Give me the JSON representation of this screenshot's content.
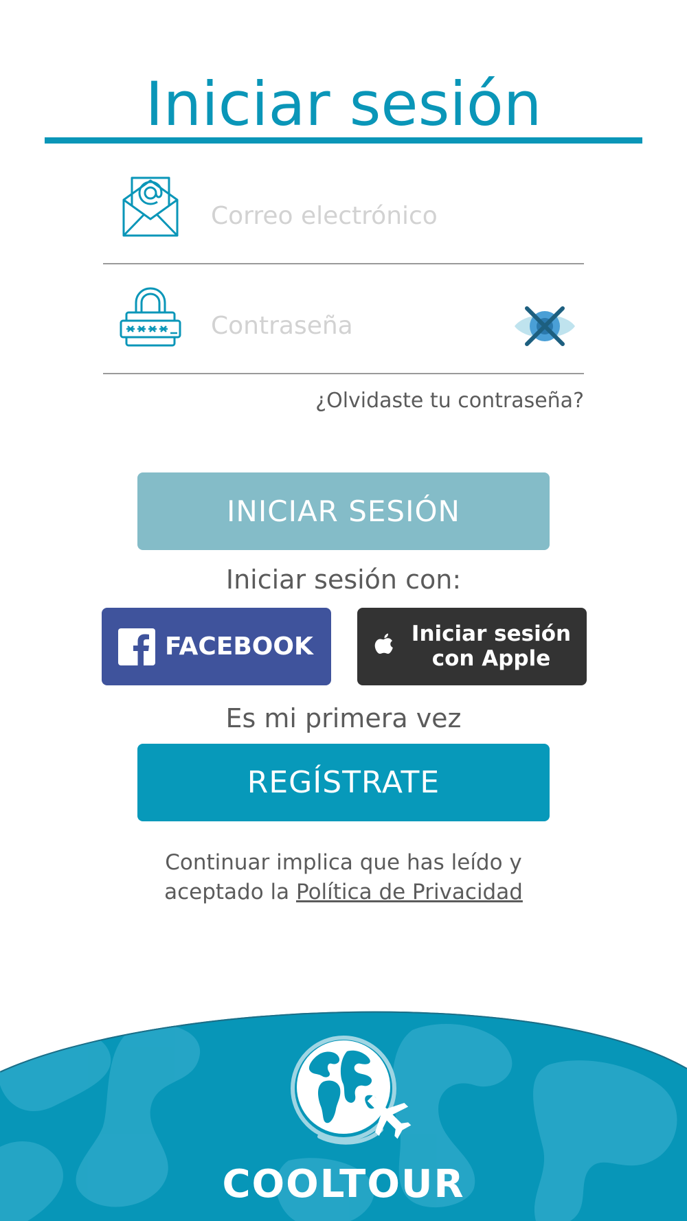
{
  "header": {
    "title": "Iniciar sesión"
  },
  "form": {
    "email_placeholder": "Correo electrónico",
    "password_placeholder": "Contraseña",
    "forgot_password": "¿Olvidaste tu contraseña?",
    "login_button": "INICIAR SESIÓN"
  },
  "social": {
    "label": "Iniciar sesión con:",
    "facebook_button": "FACEBOOK",
    "apple_button_line1": "Iniciar sesión",
    "apple_button_line2": "con Apple"
  },
  "register": {
    "label": "Es mi primera vez",
    "button": "REGÍSTRATE"
  },
  "legal": {
    "line1": "Continuar implica que has leído y",
    "line2_prefix": "aceptado la ",
    "privacy_link": "Política de Privacidad"
  },
  "brand": {
    "name": "COOLTOUR"
  },
  "icons": {
    "email": "envelope-at-icon",
    "password": "padlock-password-icon",
    "visibility": "eye-hidden-icon",
    "facebook": "facebook-logo-icon",
    "apple": "apple-logo-icon",
    "brand": "globe-airplane-logo"
  },
  "colors": {
    "primary": "#0a96b8",
    "login_button": "#84bcc8",
    "register_button": "#0799ba",
    "facebook": "#3f539c",
    "apple": "#333333",
    "text": "#5b5b5b",
    "placeholder": "#d2d2d2"
  }
}
